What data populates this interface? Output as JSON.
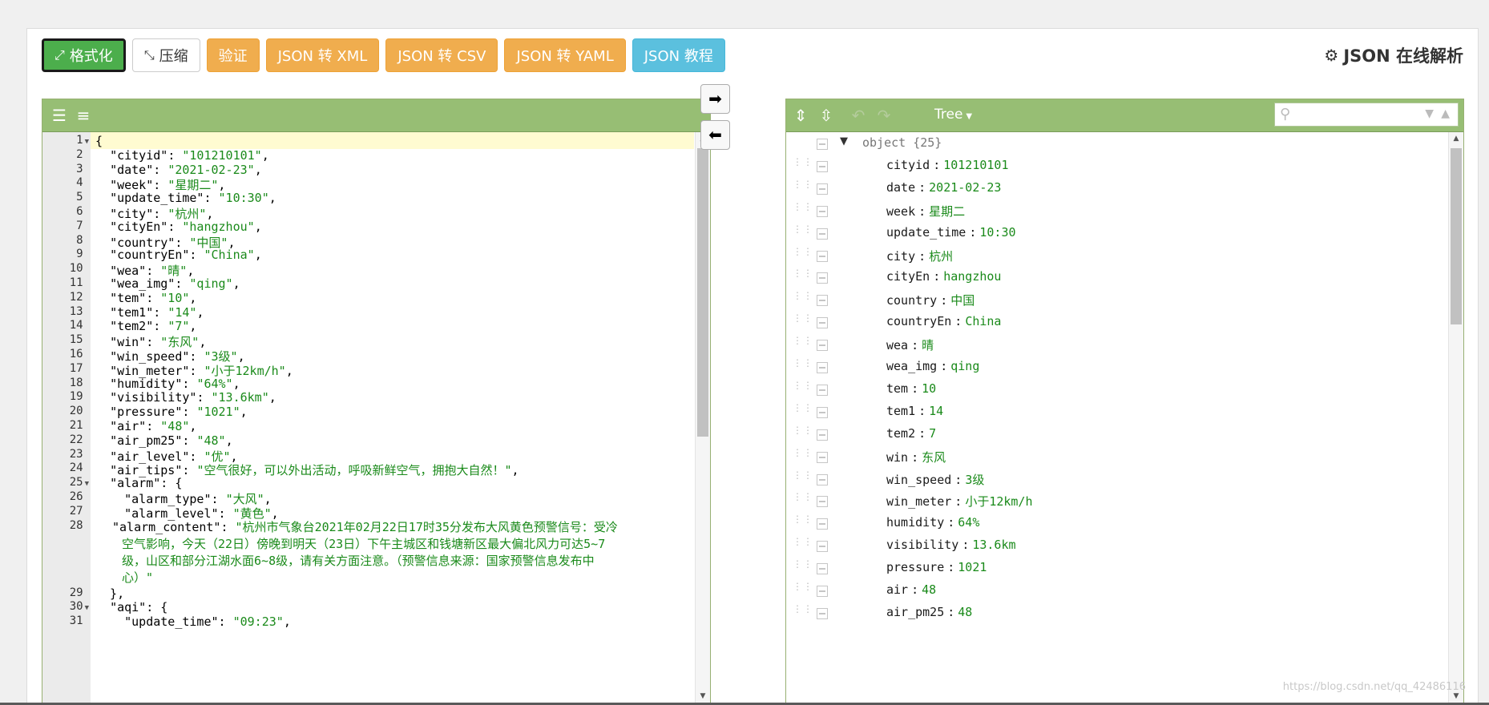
{
  "toolbar": {
    "format_label": "格式化",
    "compress_label": "压缩",
    "validate_label": "验证",
    "to_xml_label": "JSON 转 XML",
    "to_csv_label": "JSON 转 CSV",
    "to_yaml_label": "JSON 转 YAML",
    "tutorial_label": "JSON 教程"
  },
  "app_title": "JSON 在线解析",
  "editor": {
    "lines": [
      {
        "n": "1",
        "fold": true,
        "text": "{"
      },
      {
        "n": "2",
        "key": "\"cityid\"",
        "val": "\"101210101\"",
        "tail": ","
      },
      {
        "n": "3",
        "key": "\"date\"",
        "val": "\"2021-02-23\"",
        "tail": ","
      },
      {
        "n": "4",
        "key": "\"week\"",
        "val": "\"星期二\"",
        "tail": ","
      },
      {
        "n": "5",
        "key": "\"update_time\"",
        "val": "\"10:30\"",
        "tail": ","
      },
      {
        "n": "6",
        "key": "\"city\"",
        "val": "\"杭州\"",
        "tail": ","
      },
      {
        "n": "7",
        "key": "\"cityEn\"",
        "val": "\"hangzhou\"",
        "tail": ","
      },
      {
        "n": "8",
        "key": "\"country\"",
        "val": "\"中国\"",
        "tail": ","
      },
      {
        "n": "9",
        "key": "\"countryEn\"",
        "val": "\"China\"",
        "tail": ","
      },
      {
        "n": "10",
        "key": "\"wea\"",
        "val": "\"晴\"",
        "tail": ","
      },
      {
        "n": "11",
        "key": "\"wea_img\"",
        "val": "\"qing\"",
        "tail": ","
      },
      {
        "n": "12",
        "key": "\"tem\"",
        "val": "\"10\"",
        "tail": ","
      },
      {
        "n": "13",
        "key": "\"tem1\"",
        "val": "\"14\"",
        "tail": ","
      },
      {
        "n": "14",
        "key": "\"tem2\"",
        "val": "\"7\"",
        "tail": ","
      },
      {
        "n": "15",
        "key": "\"win\"",
        "val": "\"东风\"",
        "tail": ","
      },
      {
        "n": "16",
        "key": "\"win_speed\"",
        "val": "\"3级\"",
        "tail": ","
      },
      {
        "n": "17",
        "key": "\"win_meter\"",
        "val": "\"小于12km/h\"",
        "tail": ","
      },
      {
        "n": "18",
        "key": "\"humidity\"",
        "val": "\"64%\"",
        "tail": ","
      },
      {
        "n": "19",
        "key": "\"visibility\"",
        "val": "\"13.6km\"",
        "tail": ","
      },
      {
        "n": "20",
        "key": "\"pressure\"",
        "val": "\"1021\"",
        "tail": ","
      },
      {
        "n": "21",
        "key": "\"air\"",
        "val": "\"48\"",
        "tail": ","
      },
      {
        "n": "22",
        "key": "\"air_pm25\"",
        "val": "\"48\"",
        "tail": ","
      },
      {
        "n": "23",
        "key": "\"air_level\"",
        "val": "\"优\"",
        "tail": ","
      },
      {
        "n": "24",
        "key": "\"air_tips\"",
        "val": "\"空气很好，可以外出活动，呼吸新鲜空气，拥抱大自然！\"",
        "tail": ","
      },
      {
        "n": "25",
        "fold": true,
        "key": "\"alarm\"",
        "val": "{",
        "tail": ""
      },
      {
        "n": "26",
        "indent": 2,
        "key": "\"alarm_type\"",
        "val": "\"大风\"",
        "tail": ","
      },
      {
        "n": "27",
        "indent": 2,
        "key": "\"alarm_level\"",
        "val": "\"黄色\"",
        "tail": ","
      },
      {
        "n": "28",
        "indent": 2,
        "wrap": true,
        "key": "\"alarm_content\"",
        "val": "\"杭州市气象台2021年02月22日17时35分发布大风黄色预警信号：受冷空气影响，今天（22日）傍晚到明天（23日）下午主城区和钱塘新区最大偏北风力可达5~7级，山区和部分江湖水面6~8级，请有关方面注意。（预警信息来源：国家预警信息发布中心）\"",
        "tail": ""
      },
      {
        "n": "29",
        "text": "  },"
      },
      {
        "n": "30",
        "fold": true,
        "key": "\"aqi\"",
        "val": "{",
        "tail": ""
      },
      {
        "n": "31",
        "indent": 2,
        "key": "\"update_time\"",
        "val": "\"09:23\"",
        "tail": ","
      }
    ]
  },
  "tree": {
    "mode_label": "Tree",
    "root_label": "object {25}",
    "fields": [
      {
        "key": "cityid",
        "val": "101210101"
      },
      {
        "key": "date",
        "val": "2021-02-23"
      },
      {
        "key": "week",
        "val": "星期二"
      },
      {
        "key": "update_time",
        "val": "10:30"
      },
      {
        "key": "city",
        "val": "杭州"
      },
      {
        "key": "cityEn",
        "val": "hangzhou"
      },
      {
        "key": "country",
        "val": "中国"
      },
      {
        "key": "countryEn",
        "val": "China"
      },
      {
        "key": "wea",
        "val": "晴"
      },
      {
        "key": "wea_img",
        "val": "qing"
      },
      {
        "key": "tem",
        "val": "10"
      },
      {
        "key": "tem1",
        "val": "14"
      },
      {
        "key": "tem2",
        "val": "7"
      },
      {
        "key": "win",
        "val": "东风"
      },
      {
        "key": "win_speed",
        "val": "3级"
      },
      {
        "key": "win_meter",
        "val": "小于12km/h"
      },
      {
        "key": "humidity",
        "val": "64%"
      },
      {
        "key": "visibility",
        "val": "13.6km"
      },
      {
        "key": "pressure",
        "val": "1021"
      },
      {
        "key": "air",
        "val": "48"
      },
      {
        "key": "air_pm25",
        "val": "48"
      }
    ]
  },
  "watermark": "https://blog.csdn.net/qq_42486116",
  "colors": {
    "menu_bar": "#97be74",
    "string_value": "#1a8a1a",
    "active_line": "#fffbd1"
  }
}
